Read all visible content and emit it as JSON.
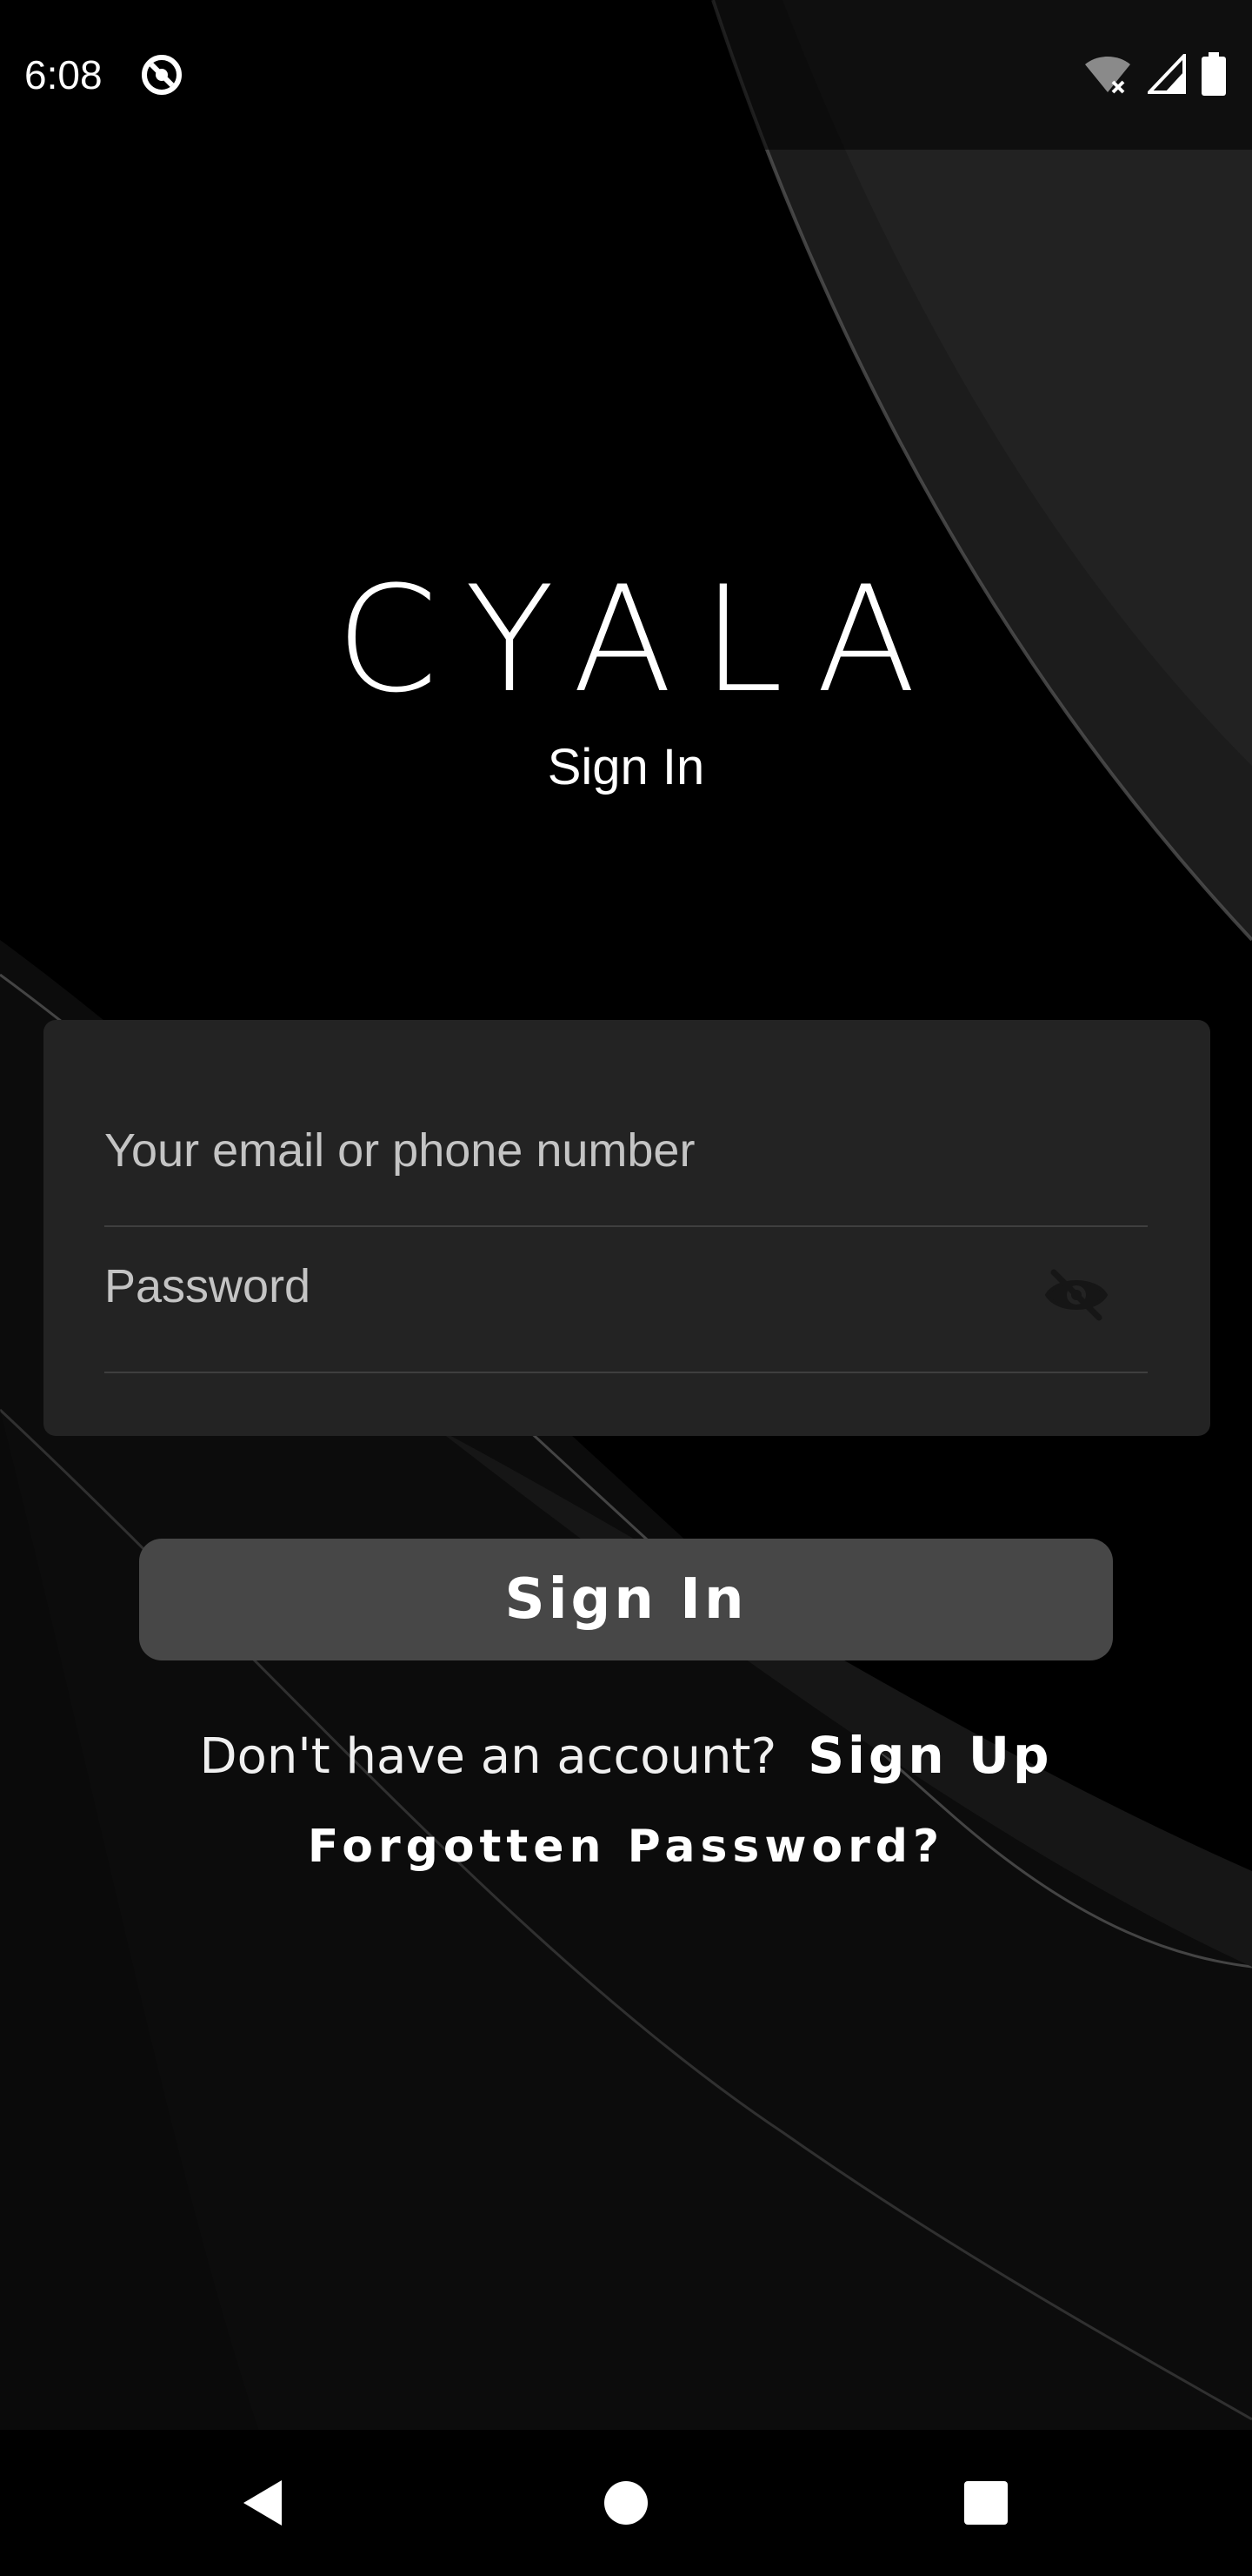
{
  "status_bar": {
    "time": "6:08",
    "app_icon": "do-not-disturb-icon",
    "wifi_icon": "wifi-off-icon",
    "signal_icon": "cellular-signal-icon",
    "battery_icon": "battery-full-icon"
  },
  "brand": {
    "logo_text": "CYALA",
    "subtitle": "Sign In"
  },
  "form": {
    "email_placeholder": "Your email or phone number",
    "email_value": "",
    "password_placeholder": "Password",
    "password_value": "",
    "toggle_icon": "eye-off-icon"
  },
  "actions": {
    "sign_in_label": "Sign In",
    "no_account_text": "Don't have an account?",
    "sign_up_label": "Sign Up",
    "forgot_label": "Forgotten Password?"
  },
  "nav_bar": {
    "back_icon": "back-triangle-icon",
    "home_icon": "home-circle-icon",
    "recents_icon": "recents-square-icon"
  },
  "colors": {
    "background": "#000000",
    "card": "#232323",
    "button": "#474747",
    "text": "#ffffff",
    "placeholder": "#c4c4c4"
  }
}
